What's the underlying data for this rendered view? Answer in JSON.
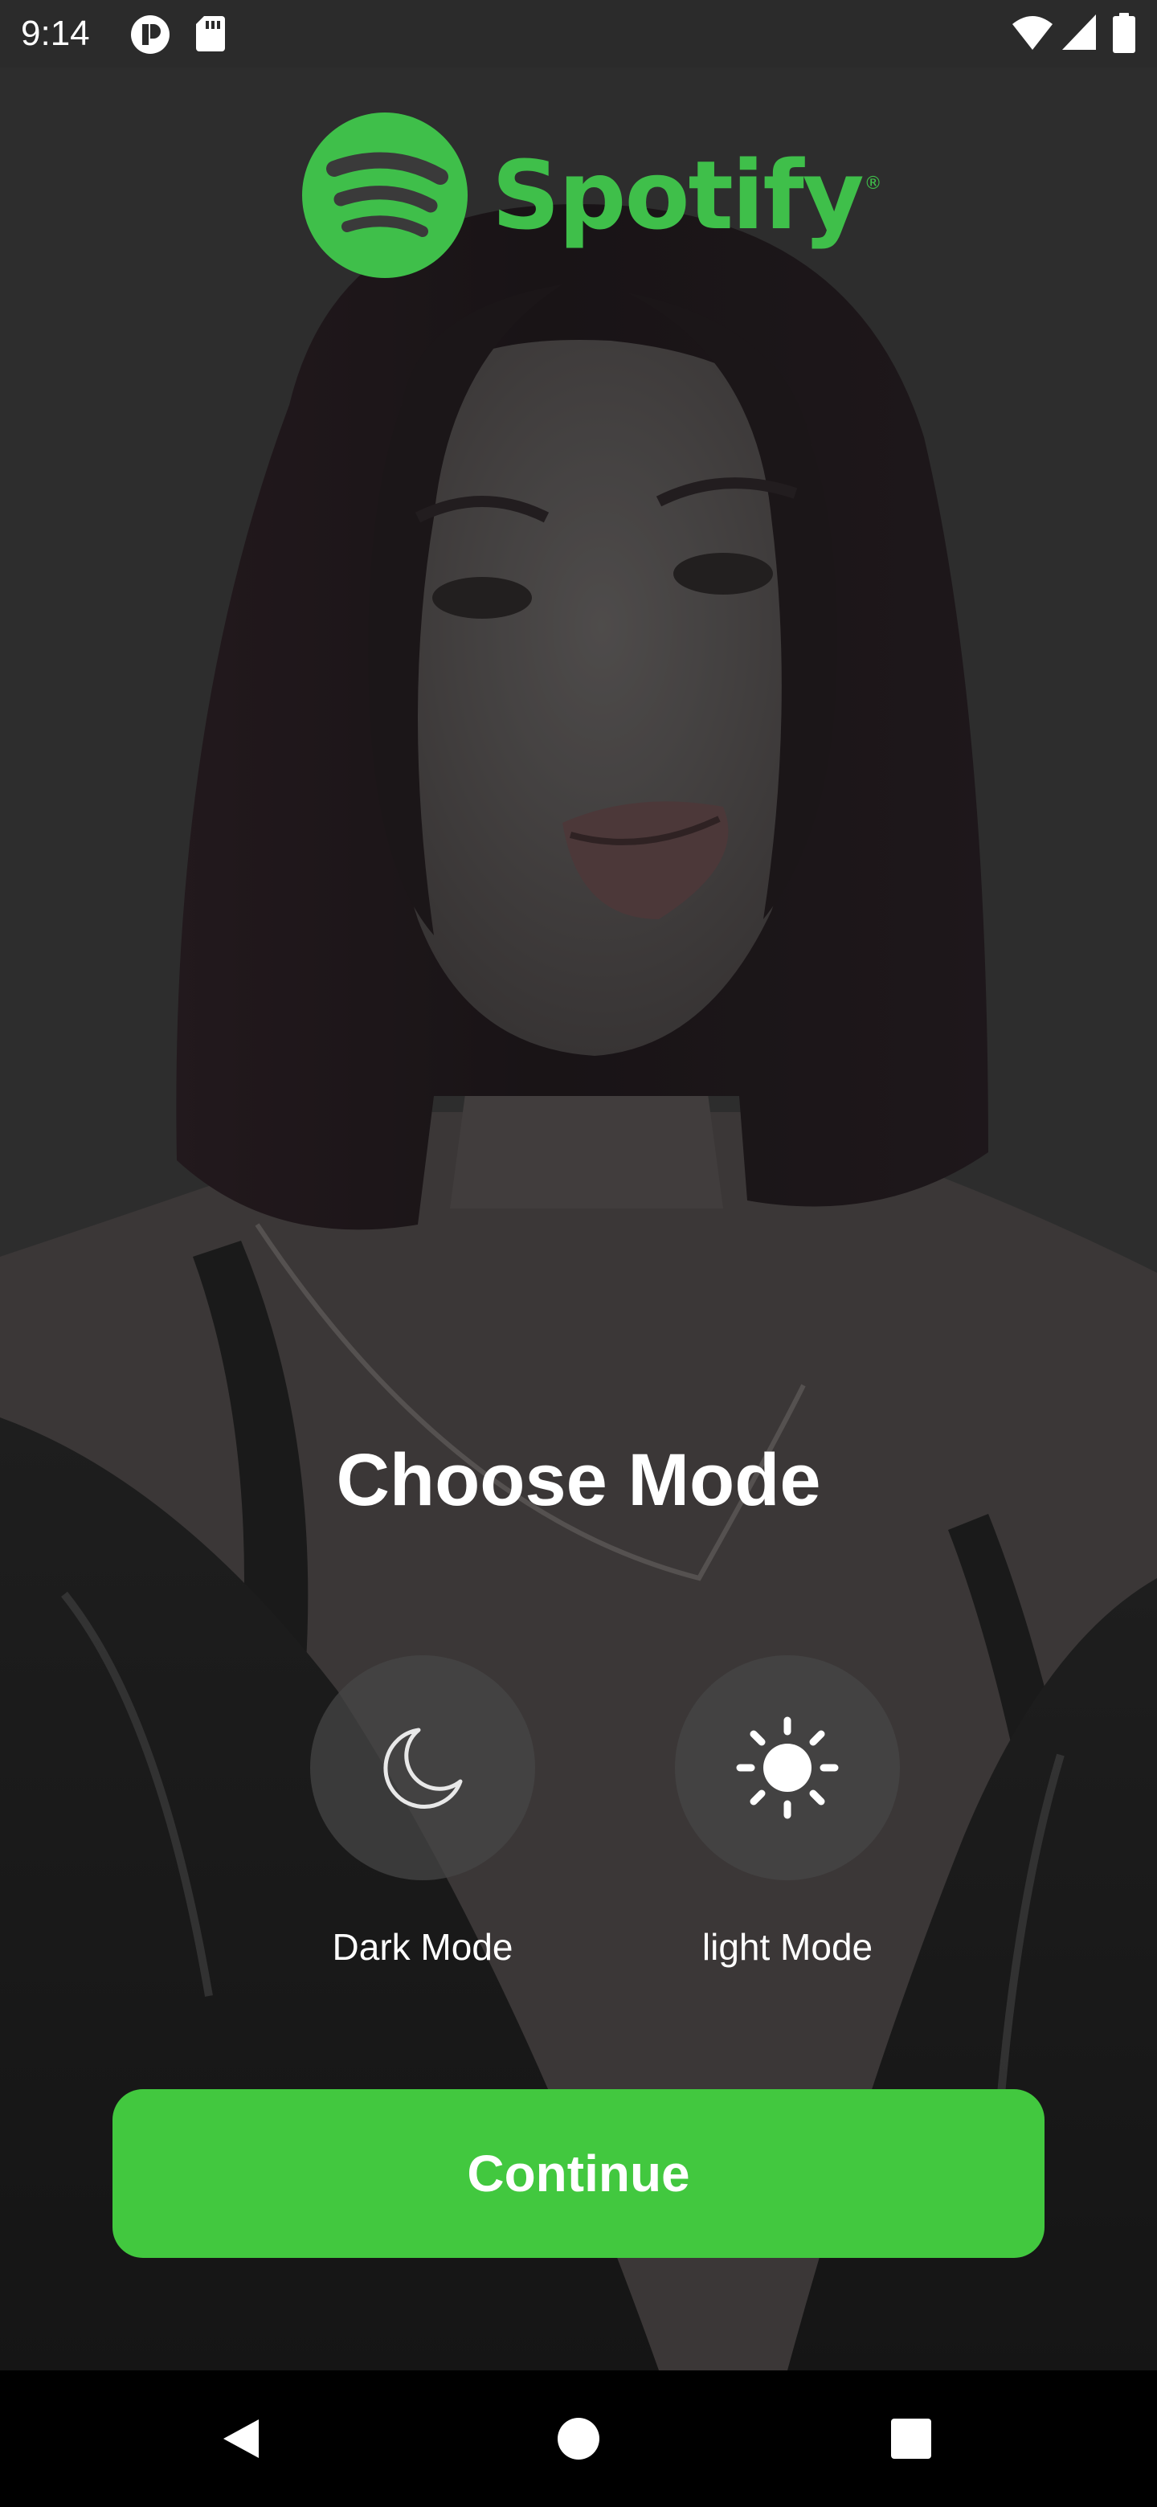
{
  "status_bar": {
    "time": "9:14"
  },
  "logo": {
    "wordmark": "Spotify",
    "registered": "®"
  },
  "main": {
    "title": "Choose Mode",
    "modes": [
      {
        "label": "Dark Mode",
        "icon": "moon-icon"
      },
      {
        "label": "light Mode",
        "icon": "sun-icon"
      }
    ],
    "continue_label": "Continue"
  },
  "colors": {
    "accent": "#42c83f",
    "logo_green": "#3fbf4a",
    "background": "#3a3a3a",
    "status_bar": "#2b2b2b",
    "nav_bar": "#000000"
  }
}
